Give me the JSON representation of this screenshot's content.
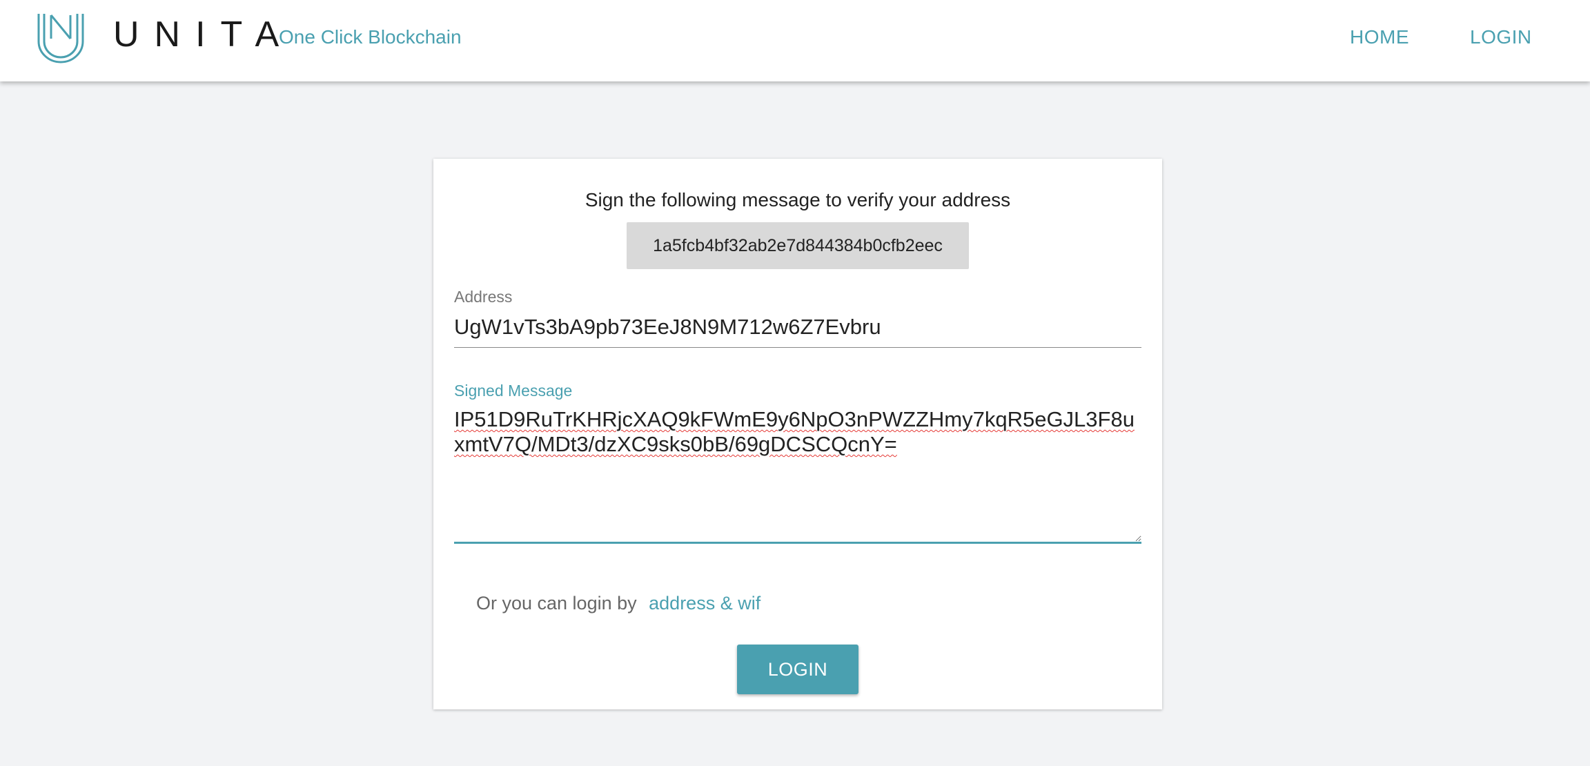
{
  "header": {
    "logo_text": "UNITA",
    "tagline": "One Click Blockchain",
    "nav": {
      "home": "HOME",
      "login": "LOGIN"
    }
  },
  "card": {
    "instruction": "Sign the following message to verify your address",
    "message_to_sign": "1a5fcb4bf32ab2e7d844384b0cfb2eec",
    "address": {
      "label": "Address",
      "value": "UgW1vTs3bA9pb73EeJ8N9M712w6Z7Evbru"
    },
    "signed_message": {
      "label": "Signed Message",
      "value": "IP51D9RuTrKHRjcXAQ9kFWmE9y6NpO3nPWZZHmy7kqR5eGJL3F8uxmtV7Q/MDt3/dzXC9sks0bB/69gDCSCQcnY="
    },
    "alt_login": {
      "prefix": "Or you can login by",
      "link": "address & wif"
    },
    "login_button": "LOGIN"
  },
  "colors": {
    "accent": "#4aa0b0",
    "background": "#f2f3f5",
    "chip": "#d9d9d9"
  }
}
